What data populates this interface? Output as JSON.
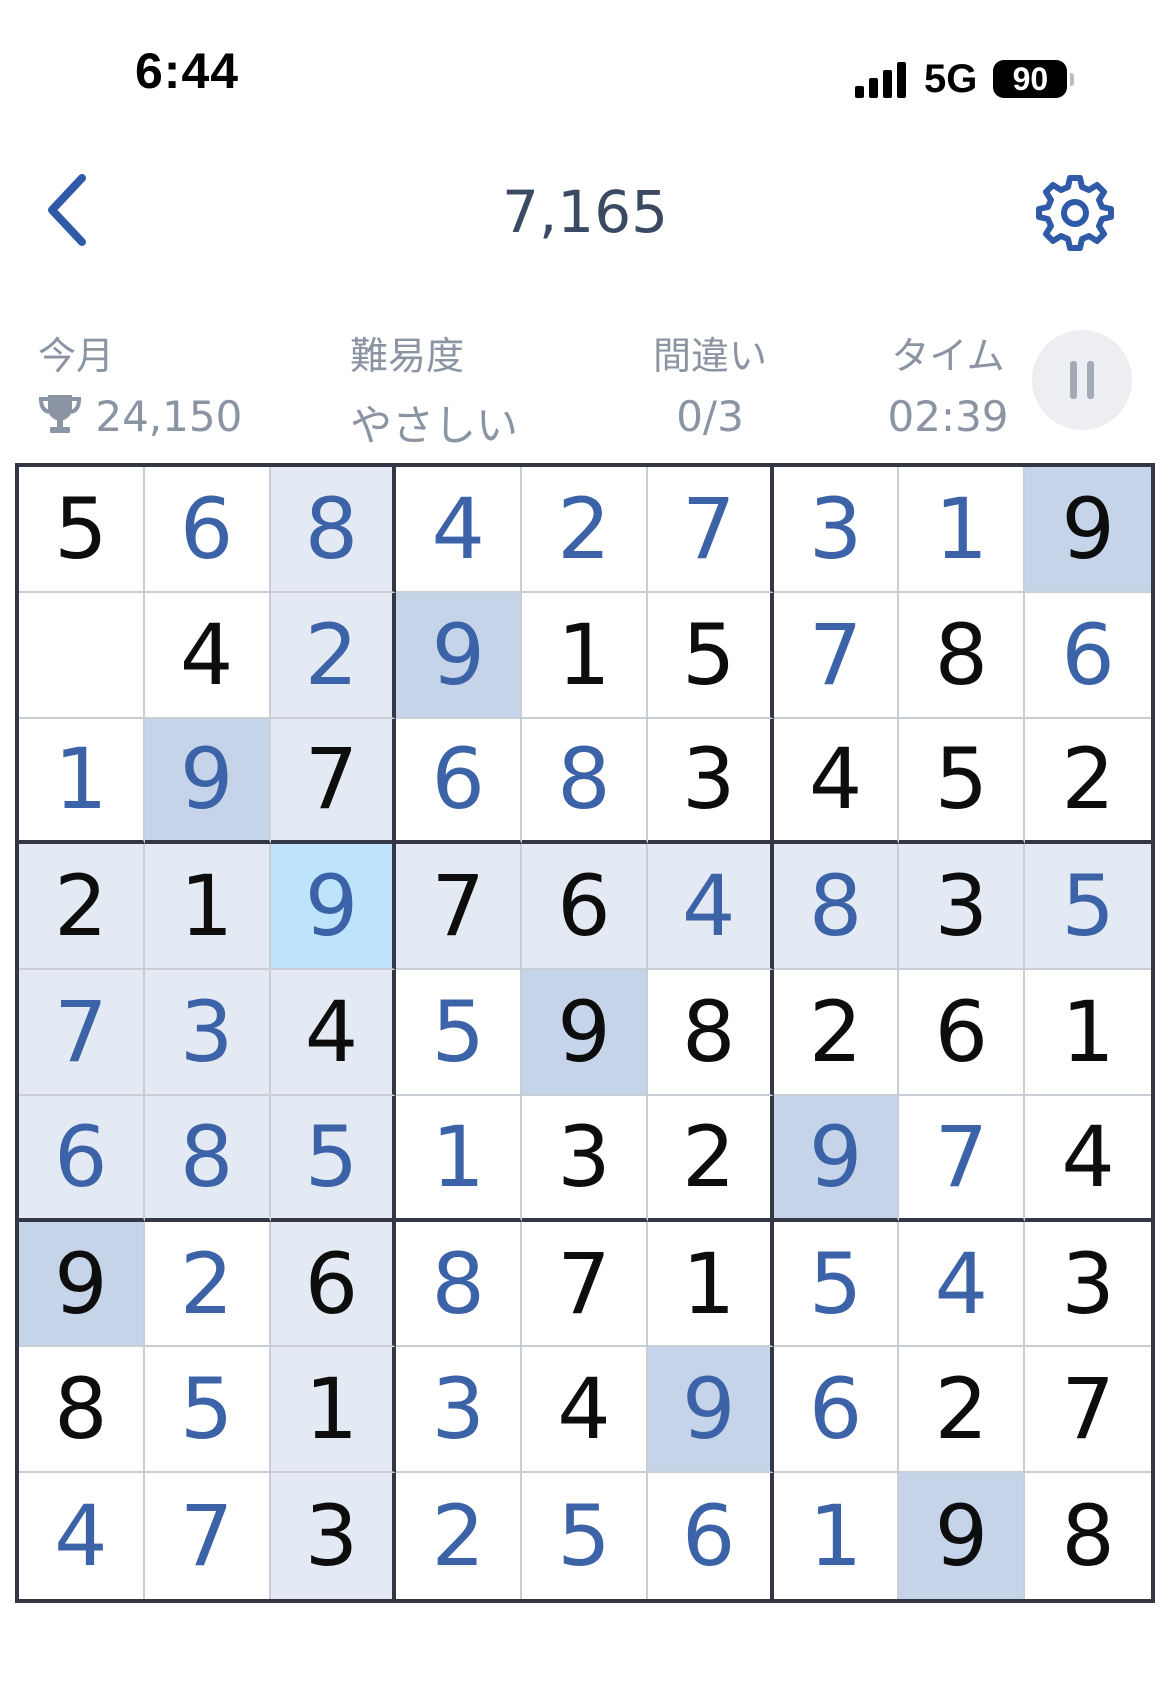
{
  "status_bar": {
    "time": "6:44",
    "network": "5G",
    "battery": "90",
    "signal_bars": 4
  },
  "header": {
    "title": "7,165",
    "back_icon": "chevron-left-icon",
    "settings_icon": "gear-icon"
  },
  "info": {
    "month": {
      "label": "今月",
      "value": "24,150",
      "icon": "trophy-icon"
    },
    "difficulty": {
      "label": "難易度",
      "value": "やさしい"
    },
    "mistakes": {
      "label": "間違い",
      "value": "0/3"
    },
    "time": {
      "label": "タイム",
      "value": "02:39"
    },
    "pause_icon": "pause-icon"
  },
  "colors": {
    "given_digit": "#0d0d0d",
    "entered_digit": "#3c62a8",
    "related_highlight": "#e3eaf3",
    "same_number_highlight": "#c5d4e8",
    "selected_cell": "#bde4fb",
    "thick_border": "#343846"
  },
  "board": {
    "selected": [
      3,
      2
    ],
    "highlighted_number": "9",
    "rows": [
      [
        [
          "5",
          "g"
        ],
        [
          "6",
          "e"
        ],
        [
          "8",
          "e"
        ],
        [
          "4",
          "e"
        ],
        [
          "2",
          "e"
        ],
        [
          "7",
          "e"
        ],
        [
          "3",
          "e"
        ],
        [
          "1",
          "e"
        ],
        [
          "9",
          "g"
        ]
      ],
      [
        [
          "",
          "e"
        ],
        [
          "4",
          "g"
        ],
        [
          "2",
          "e"
        ],
        [
          "9",
          "e"
        ],
        [
          "1",
          "g"
        ],
        [
          "5",
          "g"
        ],
        [
          "7",
          "e"
        ],
        [
          "8",
          "g"
        ],
        [
          "6",
          "e"
        ]
      ],
      [
        [
          "1",
          "e"
        ],
        [
          "9",
          "e"
        ],
        [
          "7",
          "g"
        ],
        [
          "6",
          "e"
        ],
        [
          "8",
          "e"
        ],
        [
          "3",
          "g"
        ],
        [
          "4",
          "g"
        ],
        [
          "5",
          "g"
        ],
        [
          "2",
          "g"
        ]
      ],
      [
        [
          "2",
          "g"
        ],
        [
          "1",
          "g"
        ],
        [
          "9",
          "e"
        ],
        [
          "7",
          "g"
        ],
        [
          "6",
          "g"
        ],
        [
          "4",
          "e"
        ],
        [
          "8",
          "e"
        ],
        [
          "3",
          "g"
        ],
        [
          "5",
          "e"
        ]
      ],
      [
        [
          "7",
          "e"
        ],
        [
          "3",
          "e"
        ],
        [
          "4",
          "g"
        ],
        [
          "5",
          "e"
        ],
        [
          "9",
          "g"
        ],
        [
          "8",
          "g"
        ],
        [
          "2",
          "g"
        ],
        [
          "6",
          "g"
        ],
        [
          "1",
          "g"
        ]
      ],
      [
        [
          "6",
          "e"
        ],
        [
          "8",
          "e"
        ],
        [
          "5",
          "e"
        ],
        [
          "1",
          "e"
        ],
        [
          "3",
          "g"
        ],
        [
          "2",
          "g"
        ],
        [
          "9",
          "e"
        ],
        [
          "7",
          "e"
        ],
        [
          "4",
          "g"
        ]
      ],
      [
        [
          "9",
          "g"
        ],
        [
          "2",
          "e"
        ],
        [
          "6",
          "g"
        ],
        [
          "8",
          "e"
        ],
        [
          "7",
          "g"
        ],
        [
          "1",
          "g"
        ],
        [
          "5",
          "e"
        ],
        [
          "4",
          "e"
        ],
        [
          "3",
          "g"
        ]
      ],
      [
        [
          "8",
          "g"
        ],
        [
          "5",
          "e"
        ],
        [
          "1",
          "g"
        ],
        [
          "3",
          "e"
        ],
        [
          "4",
          "g"
        ],
        [
          "9",
          "e"
        ],
        [
          "6",
          "e"
        ],
        [
          "2",
          "g"
        ],
        [
          "7",
          "g"
        ]
      ],
      [
        [
          "4",
          "e"
        ],
        [
          "7",
          "e"
        ],
        [
          "3",
          "g"
        ],
        [
          "2",
          "e"
        ],
        [
          "5",
          "e"
        ],
        [
          "6",
          "e"
        ],
        [
          "1",
          "e"
        ],
        [
          "9",
          "g"
        ],
        [
          "8",
          "g"
        ]
      ]
    ]
  }
}
